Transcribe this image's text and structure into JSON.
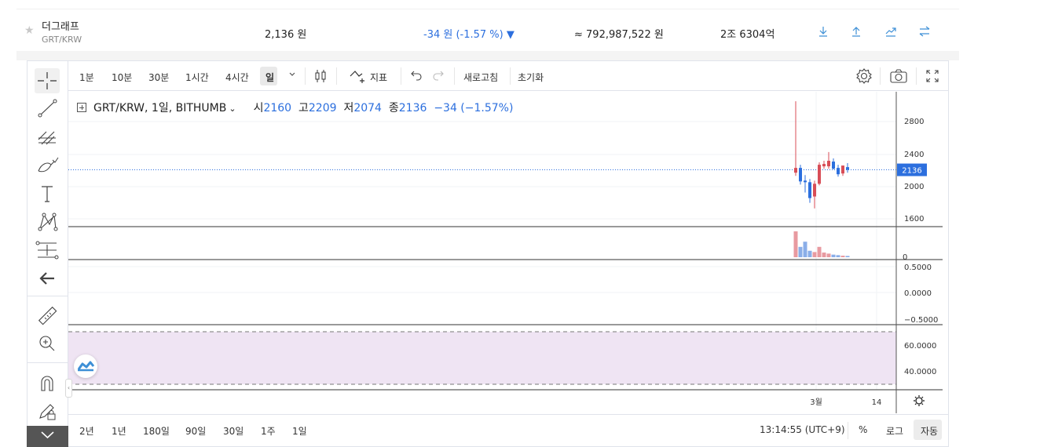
{
  "ticker": {
    "name": "더그래프",
    "pair": "GRT/KRW",
    "price": "2,136 원",
    "change": "-34 원 (-1.57 %) ▼",
    "volume": "≈ 792,987,522 원",
    "amount": "2조 6304억",
    "icons": [
      "star-icon",
      "download-icon",
      "upload-icon",
      "trend-icon",
      "swap-icon"
    ],
    "colors": {
      "down": "#2c6fde",
      "up": "#d84d57"
    }
  },
  "toolbar": {
    "intervals": [
      "1분",
      "10분",
      "30분",
      "1시간",
      "4시간",
      "일"
    ],
    "selected_interval": "일",
    "indicators_label": "지표",
    "refresh_label": "새로고침",
    "reset_label": "초기화",
    "icons": [
      "chevron-down-icon",
      "candle-type-icon",
      "indicators-icon",
      "undo-icon",
      "redo-icon",
      "settings-icon",
      "camera-icon",
      "fullscreen-icon"
    ]
  },
  "left_tools": [
    "crosshair-icon",
    "trendline-icon",
    "fib-icon",
    "brush-icon",
    "text-icon",
    "pattern-icon",
    "measure-tool-icon",
    "back-arrow-icon",
    "ruler-icon",
    "zoom-in-icon",
    "magnet-icon",
    "lock-pencil-icon",
    "chevron-down-icon"
  ],
  "legend": {
    "symbol": "GRT/KRW, 1일, BITHUMB",
    "open_label": "시",
    "open": "2160",
    "high_label": "고",
    "high": "2209",
    "low_label": "저",
    "low": "2074",
    "close_label": "종",
    "close": "2136",
    "change": "−34 (−1.57%)"
  },
  "chart_data": {
    "type": "candlestick",
    "price_ticks": [
      "2800",
      "2400",
      "2000",
      "1600"
    ],
    "last_price_tag": "2136",
    "volume_tick": "0",
    "osc_ticks": [
      "0.5000",
      "0.0000",
      "−0.5000"
    ],
    "rsi_ticks": [
      "60.0000",
      "40.0000"
    ],
    "x_ticks": [
      "3월",
      "14"
    ],
    "candles": [
      {
        "o": 2100,
        "h": 3000,
        "l": 2060,
        "c": 2160
      },
      {
        "o": 2160,
        "h": 2200,
        "l": 1950,
        "c": 1990
      },
      {
        "o": 2000,
        "h": 2070,
        "l": 1850,
        "c": 1980
      },
      {
        "o": 1980,
        "h": 2020,
        "l": 1720,
        "c": 1780
      },
      {
        "o": 1800,
        "h": 2000,
        "l": 1650,
        "c": 1960
      },
      {
        "o": 1960,
        "h": 2230,
        "l": 1940,
        "c": 2200
      },
      {
        "o": 2180,
        "h": 2250,
        "l": 2150,
        "c": 2210
      },
      {
        "o": 2180,
        "h": 2360,
        "l": 2150,
        "c": 2250
      },
      {
        "o": 2240,
        "h": 2280,
        "l": 2140,
        "c": 2150
      },
      {
        "o": 2160,
        "h": 2200,
        "l": 2050,
        "c": 2080
      },
      {
        "o": 2090,
        "h": 2180,
        "l": 2060,
        "c": 2190
      },
      {
        "o": 2170,
        "h": 2220,
        "l": 2100,
        "c": 2136
      }
    ],
    "volumes": [
      100,
      40,
      60,
      25,
      20,
      40,
      18,
      14,
      10,
      8,
      6,
      5
    ],
    "price_range": [
      1420,
      3120
    ]
  },
  "bottom_bar": {
    "ranges": [
      "2년",
      "1년",
      "180일",
      "90일",
      "30일",
      "1주",
      "1일"
    ],
    "time": "13:14:55 (UTC+9)",
    "percent": "%",
    "log": "로그",
    "auto": "자동"
  }
}
